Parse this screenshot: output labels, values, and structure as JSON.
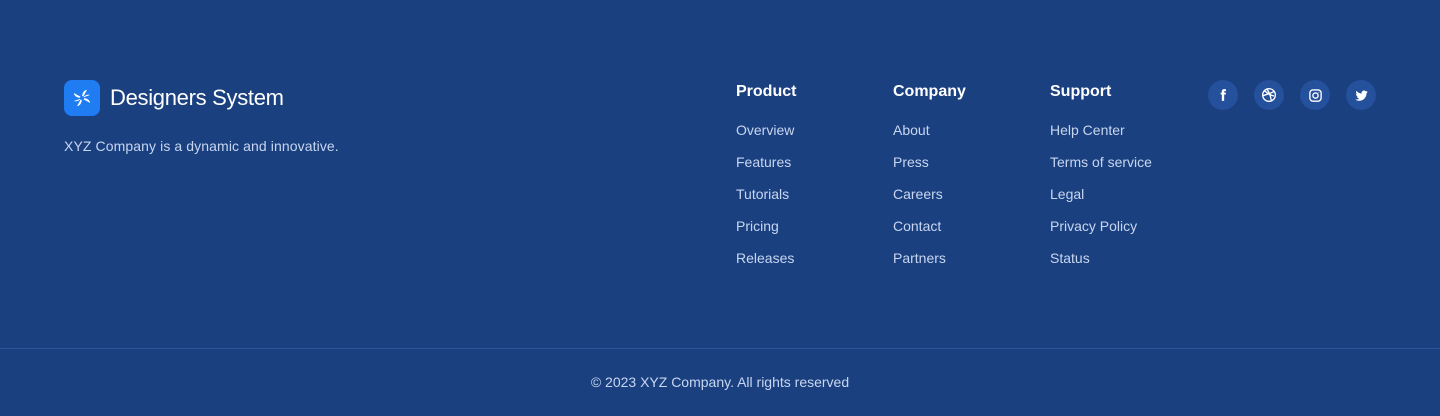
{
  "brand": {
    "name": "Designers System",
    "description": "XYZ Company is a dynamic and innovative.",
    "logo_icon": "pinwheel-logo-icon",
    "logo_color": "#1f7cf2"
  },
  "columns": [
    {
      "title": "Product",
      "links": [
        "Overview",
        "Features",
        "Tutorials",
        "Pricing",
        "Releases"
      ]
    },
    {
      "title": "Company",
      "links": [
        "About",
        "Press",
        "Careers",
        "Contact",
        "Partners"
      ]
    },
    {
      "title": "Support",
      "links": [
        "Help Center",
        "Terms of service",
        "Legal",
        "Privacy Policy",
        "Status"
      ]
    }
  ],
  "socials": [
    "facebook-icon",
    "dribbble-icon",
    "instagram-icon",
    "twitter-icon"
  ],
  "copyright": "© 2023 XYZ Company. All rights reserved",
  "colors": {
    "background": "#1b4080",
    "social_bg": "#24509c",
    "muted_text": "#c7d6f0"
  }
}
